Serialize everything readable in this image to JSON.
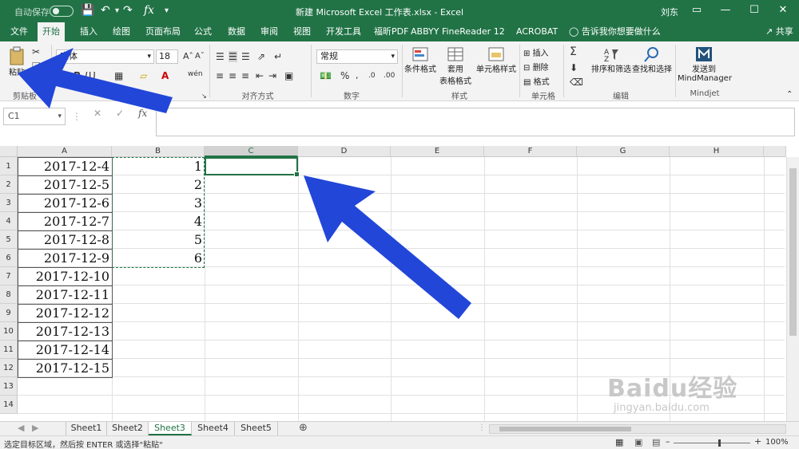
{
  "titlebar": {
    "autosave_label": "自动保存",
    "autosave_state": "关",
    "title": "新建 Microsoft Excel 工作表.xlsx  -  Excel",
    "user": "刘东"
  },
  "tabs": [
    {
      "label": "文件"
    },
    {
      "label": "开始"
    },
    {
      "label": "插入"
    },
    {
      "label": "绘图"
    },
    {
      "label": "页面布局"
    },
    {
      "label": "公式"
    },
    {
      "label": "数据"
    },
    {
      "label": "审阅"
    },
    {
      "label": "视图"
    },
    {
      "label": "开发工具"
    },
    {
      "label": "福昕PDF"
    },
    {
      "label": "ABBYY FineReader 12"
    },
    {
      "label": "ACROBAT"
    }
  ],
  "tell_me": "告诉我你想要做什么",
  "share": "共享",
  "ribbon": {
    "paste": "粘贴",
    "font_name": "宋体",
    "font_size": "18",
    "number_format": "常规",
    "conditional_format": "条件格式",
    "table_format_1": "套用",
    "table_format_2": "表格格式",
    "cell_style": "单元格样式",
    "insert": "插入",
    "delete": "删除",
    "format": "格式",
    "sort_filter": "排序和筛选",
    "find_select": "查找和选择",
    "send_1": "发送到",
    "send_2": "MindManager",
    "groups": {
      "clipboard": "剪贴板",
      "font": "字体",
      "alignment": "对齐方式",
      "number": "数字",
      "styles": "样式",
      "cells": "单元格",
      "editing": "编辑",
      "mindjet": "Mindjet"
    }
  },
  "formula_bar": {
    "name_box": "C1",
    "formula": ""
  },
  "columns": [
    "A",
    "B",
    "C",
    "D",
    "E",
    "F",
    "G",
    "H"
  ],
  "rows": [
    "1",
    "2",
    "3",
    "4",
    "5",
    "6",
    "7",
    "8",
    "9",
    "10",
    "11",
    "12",
    "13",
    "14"
  ],
  "cells": {
    "A": [
      "2017-12-4",
      "2017-12-5",
      "2017-12-6",
      "2017-12-7",
      "2017-12-8",
      "2017-12-9",
      "2017-12-10",
      "2017-12-11",
      "2017-12-12",
      "2017-12-13",
      "2017-12-14",
      "2017-12-15"
    ],
    "B": [
      "1",
      "2",
      "3",
      "4",
      "5",
      "6"
    ]
  },
  "sheets": [
    {
      "label": "Sheet1"
    },
    {
      "label": "Sheet2"
    },
    {
      "label": "Sheet3"
    },
    {
      "label": "Sheet4"
    },
    {
      "label": "Sheet5"
    }
  ],
  "active_sheet": "Sheet3",
  "status": {
    "message": "选定目标区域，然后按 ENTER 或选择\"粘贴\"",
    "zoom": "100%"
  },
  "watermark": {
    "brand": "Baidu经验",
    "url": "jingyan.baidu.com"
  },
  "accent_color": "#217346",
  "arrow_color": "#2246d8"
}
